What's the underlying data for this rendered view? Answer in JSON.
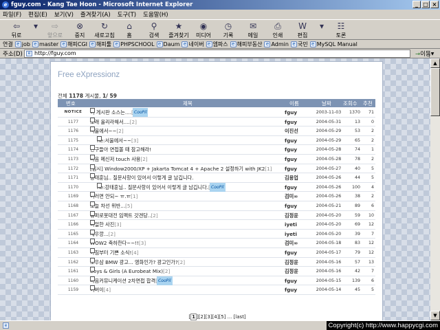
{
  "window": {
    "title": "fguy.com - Kang Tae Hoon - Microsoft Internet Explorer"
  },
  "menu": [
    "파일(F)",
    "편집(E)",
    "보기(V)",
    "즐겨찾기(A)",
    "도구(T)",
    "도움말(H)"
  ],
  "toolbar": [
    {
      "label": "뒤로",
      "icon": "back-arrow-icon",
      "glyph": "⇦",
      "disabled": false
    },
    {
      "label": "",
      "icon": "dropdown-arrow-icon",
      "glyph": "▾",
      "disabled": false
    },
    {
      "label": "앞으로",
      "icon": "forward-arrow-icon",
      "glyph": "⇨",
      "disabled": true
    },
    {
      "label": "중지",
      "icon": "stop-icon",
      "glyph": "⊗",
      "disabled": false
    },
    {
      "label": "새로고침",
      "icon": "refresh-icon",
      "glyph": "↻",
      "disabled": false
    },
    {
      "label": "홈",
      "icon": "home-icon",
      "glyph": "⌂",
      "disabled": false
    },
    {
      "label": "검색",
      "icon": "search-icon",
      "glyph": "⚲",
      "disabled": false
    },
    {
      "label": "즐겨찾기",
      "icon": "favorites-icon",
      "glyph": "★",
      "disabled": false
    },
    {
      "label": "미디어",
      "icon": "media-icon",
      "glyph": "◉",
      "disabled": false
    },
    {
      "label": "기록",
      "icon": "history-icon",
      "glyph": "◷",
      "disabled": false
    },
    {
      "label": "메일",
      "icon": "mail-icon",
      "glyph": "✉",
      "disabled": false
    },
    {
      "label": "인쇄",
      "icon": "print-icon",
      "glyph": "⎙",
      "disabled": false
    },
    {
      "label": "편집",
      "icon": "edit-icon",
      "glyph": "W",
      "disabled": false
    },
    {
      "label": "",
      "icon": "dropdown-arrow-icon",
      "glyph": "▾",
      "disabled": false
    },
    {
      "label": "토론",
      "icon": "discuss-icon",
      "glyph": "☷",
      "disabled": false
    }
  ],
  "links": {
    "label": "연결",
    "items": [
      "job",
      "master",
      "해피CGI",
      "해피툴",
      "PHPSCHOOL",
      "Daum",
      "네이버",
      "엠파스",
      "해피부동산",
      "Admin",
      "국민",
      "MySQL Manual"
    ]
  },
  "address": {
    "label": "주소(D)",
    "value": "http://fguy.com",
    "go": "이동"
  },
  "page": {
    "title": "Free eXpressionz",
    "count_label": "전체",
    "count_value": "1178",
    "count_suffix": "게시물,",
    "page_value": "1/ 59",
    "headers": {
      "no": "번호",
      "title": "제목",
      "name": "이름",
      "date": "날짜",
      "hits": "조회수",
      "rec": "추천"
    },
    "rows": [
      {
        "no": "NOTICE",
        "title": "이 게시판 소스는....",
        "comments": "[2]",
        "cool": "CooPil",
        "reply": false,
        "name": "fguy",
        "date": "2003-11-03",
        "hits": "1370",
        "rec": "71"
      },
      {
        "no": "1177",
        "title": "노래 올리라해서....",
        "comments": "[2]",
        "cool": "",
        "reply": false,
        "name": "fguy",
        "date": "2004-05-31",
        "hits": "13",
        "rec": "0"
      },
      {
        "no": "1176",
        "title": "서울에서~~",
        "comments": "[2]",
        "cool": "",
        "reply": false,
        "name": "이진선",
        "date": "2004-05-29",
        "hits": "53",
        "rec": "2"
      },
      {
        "no": "1175",
        "title": "Re:서울에서~~",
        "comments": "[3]",
        "cool": "",
        "reply": true,
        "name": "fguy",
        "date": "2004-05-29",
        "hits": "65",
        "rec": "2"
      },
      {
        "no": "1174",
        "title": "친구들아 면접볼 때 참고해라!",
        "comments": "",
        "cool": "",
        "reply": false,
        "name": "fguy",
        "date": "2004-05-28",
        "hits": "74",
        "rec": "1"
      },
      {
        "no": "1173",
        "title": "다음 메신저 touch 사용",
        "comments": "[2]",
        "cool": "",
        "reply": false,
        "name": "fguy",
        "date": "2004-05-28",
        "hits": "78",
        "rec": "2"
      },
      {
        "no": "1172",
        "title": "[임시] Window2000/XP + Jakarta Tomcat 4 + Apache 2 설정하기 with JK2",
        "comments": "[1]",
        "cool": "",
        "reply": false,
        "name": "fguy",
        "date": "2004-05-27",
        "hits": "40",
        "rec": "5"
      },
      {
        "no": "1171",
        "title": "강태훈님.. 질문사항이 있어서 이렇게 글 남깁니다.",
        "comments": "",
        "cool": "",
        "reply": false,
        "name": "김용업",
        "date": "2004-05-26",
        "hits": "44",
        "rec": "5"
      },
      {
        "no": "1170",
        "title": "Re:강태훈님.. 질문사항이 있어서 이렇게 글 남깁니다.",
        "comments": "[8]",
        "cool": "CooPil",
        "reply": true,
        "name": "fguy",
        "date": "2004-05-26",
        "hits": "100",
        "rec": "4"
      },
      {
        "no": "1169",
        "title": "이러면 안되~ ㅠ.ㅠ",
        "comments": "[1]",
        "cool": "",
        "reply": false,
        "name": "검미∞",
        "date": "2004-05-26",
        "hits": "38",
        "rec": "2"
      },
      {
        "no": "1168",
        "title": "오늘 차선 위반...",
        "comments": "[5]",
        "cool": "",
        "reply": false,
        "name": "fguy",
        "date": "2004-05-21",
        "hits": "89",
        "rec": "6"
      },
      {
        "no": "1167",
        "title": "슈퍼로봇대전 임팩트 갓겐당..",
        "comments": "[2]",
        "cool": "",
        "reply": false,
        "name": "김정윤",
        "date": "2004-05-20",
        "hits": "59",
        "rec": "10"
      },
      {
        "no": "1166",
        "title": "리얼한 사진",
        "comments": "[3]",
        "cool": "",
        "reply": false,
        "name": "iyeti",
        "date": "2004-05-20",
        "hits": "69",
        "rec": "12"
      },
      {
        "no": "1165",
        "title": "새우깡...",
        "comments": "[2]",
        "cool": "",
        "reply": false,
        "name": "iyeti",
        "date": "2004-05-20",
        "hits": "39",
        "rec": "7"
      },
      {
        "no": "1164",
        "title": "WOW2 축하한다~~!!",
        "comments": "[3]",
        "cool": "",
        "reply": false,
        "name": "검미∞",
        "date": "2004-05-18",
        "hits": "83",
        "rec": "12"
      },
      {
        "no": "1163",
        "title": "아침부터 기쁜 소식!",
        "comments": "[4]",
        "cool": "",
        "reply": false,
        "name": "fguy",
        "date": "2004-05-17",
        "hits": "79",
        "rec": "12"
      },
      {
        "no": "1162",
        "title": "오우삼 BMW 광고... 영화인가? 광고인가?",
        "comments": "[2]",
        "cool": "",
        "reply": false,
        "name": "김정윤",
        "date": "2004-05-16",
        "hits": "57",
        "rec": "13"
      },
      {
        "no": "1161",
        "title": "Boys & Girls (A Eurobeat Mix)",
        "comments": "[2]",
        "cool": "",
        "reply": false,
        "name": "김정윤",
        "date": "2004-05-16",
        "hits": "42",
        "rec": "7"
      },
      {
        "no": "1160",
        "title": "다음커뮤니케이션 2차면접 합격",
        "comments": "[6]",
        "cool": "CooPil",
        "reply": false,
        "name": "fguy",
        "date": "2004-05-15",
        "hits": "139",
        "rec": "6"
      },
      {
        "no": "1159",
        "title": "어버이",
        "comments": "[4]",
        "cool": "",
        "reply": false,
        "name": "fguy",
        "date": "2004-05-14",
        "hits": "45",
        "rec": "5"
      }
    ],
    "pager": {
      "pages": [
        "1",
        "2",
        "3",
        "4",
        "5"
      ],
      "current": "1",
      "more": "...",
      "last": "[last]"
    }
  },
  "status": {
    "copyright": "Copyright(c) http://www.happycgi.com"
  }
}
